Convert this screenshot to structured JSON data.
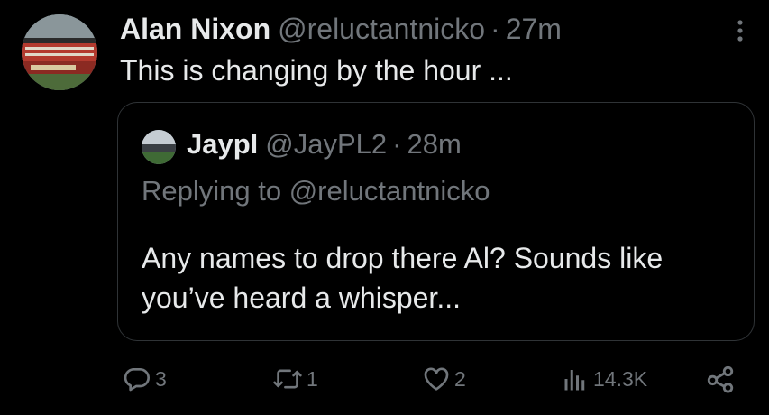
{
  "tweet": {
    "display_name": "Alan Nixon",
    "handle": "@reluctantnicko",
    "separator": "·",
    "time": "27m",
    "text": "This is changing by the hour ..."
  },
  "quote": {
    "display_name": "Jaypl",
    "handle": "@JayPL2",
    "separator": "·",
    "time": "28m",
    "replying_to": "Replying to @reluctantnicko",
    "text": "Any names to drop there Al? Sounds like you’ve heard a whisper..."
  },
  "actions": {
    "replies": "3",
    "reposts": "1",
    "likes": "2",
    "views": "14.3K"
  },
  "icons": {
    "more": "more-vertical-icon",
    "reply": "reply-icon",
    "repost": "repost-icon",
    "like": "heart-icon",
    "views": "views-chart-icon",
    "share": "share-icon"
  },
  "colors": {
    "background": "#000000",
    "primary_text": "#e7e9ea",
    "secondary_text": "#71767b",
    "border": "#2f3336"
  }
}
